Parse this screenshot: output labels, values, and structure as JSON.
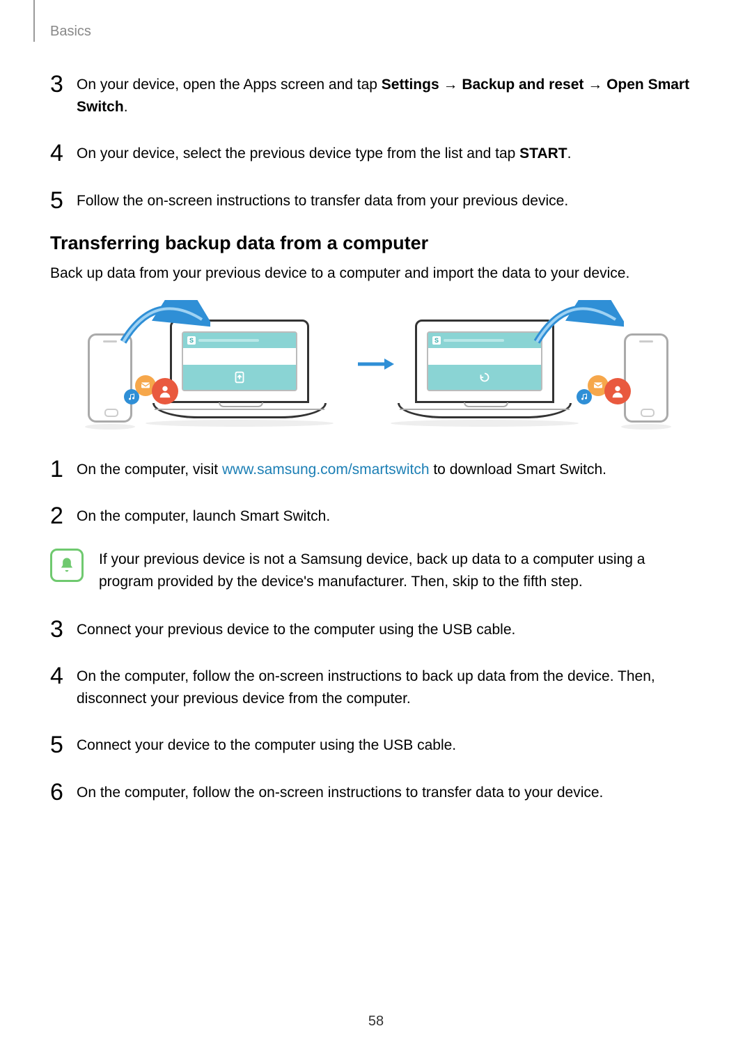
{
  "breadcrumb": "Basics",
  "page_number": "58",
  "steps_a": {
    "s3": {
      "num": "3",
      "pre": "On your device, open the Apps screen and tap ",
      "b1": "Settings",
      "a1": " → ",
      "b2": "Backup and reset",
      "a2": " → ",
      "b3": "Open Smart Switch",
      "post": "."
    },
    "s4": {
      "num": "4",
      "pre": "On your device, select the previous device type from the list and tap ",
      "b1": "START",
      "post": "."
    },
    "s5": {
      "num": "5",
      "text": "Follow the on-screen instructions to transfer data from your previous device."
    }
  },
  "section": {
    "heading": "Transferring backup data from a computer",
    "desc": "Back up data from your previous device to a computer and import the data to your device."
  },
  "steps_b": {
    "s1": {
      "num": "1",
      "pre": "On the computer, visit ",
      "link": "www.samsung.com/smartswitch",
      "post": " to download Smart Switch."
    },
    "s2": {
      "num": "2",
      "text": "On the computer, launch Smart Switch."
    },
    "s3": {
      "num": "3",
      "text": "Connect your previous device to the computer using the USB cable."
    },
    "s4": {
      "num": "4",
      "text": "On the computer, follow the on-screen instructions to back up data from the device. Then, disconnect your previous device from the computer."
    },
    "s5": {
      "num": "5",
      "text": "Connect your device to the computer using the USB cable."
    },
    "s6": {
      "num": "6",
      "text": "On the computer, follow the on-screen instructions to transfer data to your device."
    }
  },
  "note": "If your previous device is not a Samsung device, back up data to a computer using a program provided by the device's manufacturer. Then, skip to the fifth step."
}
